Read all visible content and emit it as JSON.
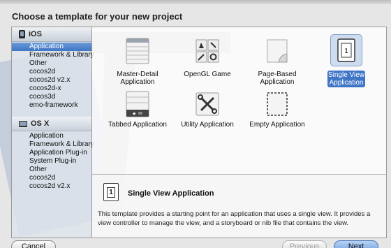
{
  "dialog": {
    "title": "Choose a template for your new project"
  },
  "sidebar": {
    "sections": [
      {
        "name": "iOS",
        "items": [
          "Application",
          "Framework & Library",
          "Other",
          "cocos2d",
          "cocos2d v2.x",
          "cocos2d-x",
          "cocos3d",
          "emo-framework"
        ]
      },
      {
        "name": "OS X",
        "items": [
          "Application",
          "Framework & Library",
          "Application Plug-in",
          "System Plug-in",
          "Other",
          "cocos2d",
          "cocos2d v2.x"
        ]
      }
    ],
    "selected": "iOS / Application"
  },
  "templates": [
    {
      "label": "Master-Detail Application",
      "icon": "master-detail-icon"
    },
    {
      "label": "OpenGL Game",
      "icon": "opengl-game-icon"
    },
    {
      "label": "Page-Based Application",
      "icon": "page-based-icon"
    },
    {
      "label": "Single View Application",
      "icon": "single-view-icon",
      "selected": true
    },
    {
      "label": "Tabbed Application",
      "icon": "tabbed-icon"
    },
    {
      "label": "Utility Application",
      "icon": "utility-icon"
    },
    {
      "label": "Empty Application",
      "icon": "empty-app-icon"
    }
  ],
  "description": {
    "icon_text": "1",
    "title": "Single View Application",
    "text": "This template provides a starting point for an application that uses a single view. It provides a view controller to manage the view, and a storyboard or nib file that contains the view."
  },
  "buttons": {
    "cancel": "Cancel",
    "previous": "Previous",
    "next": "Next"
  },
  "colors": {
    "selection": "#3f75c6",
    "sidebar_bg": "#dee4ec"
  }
}
